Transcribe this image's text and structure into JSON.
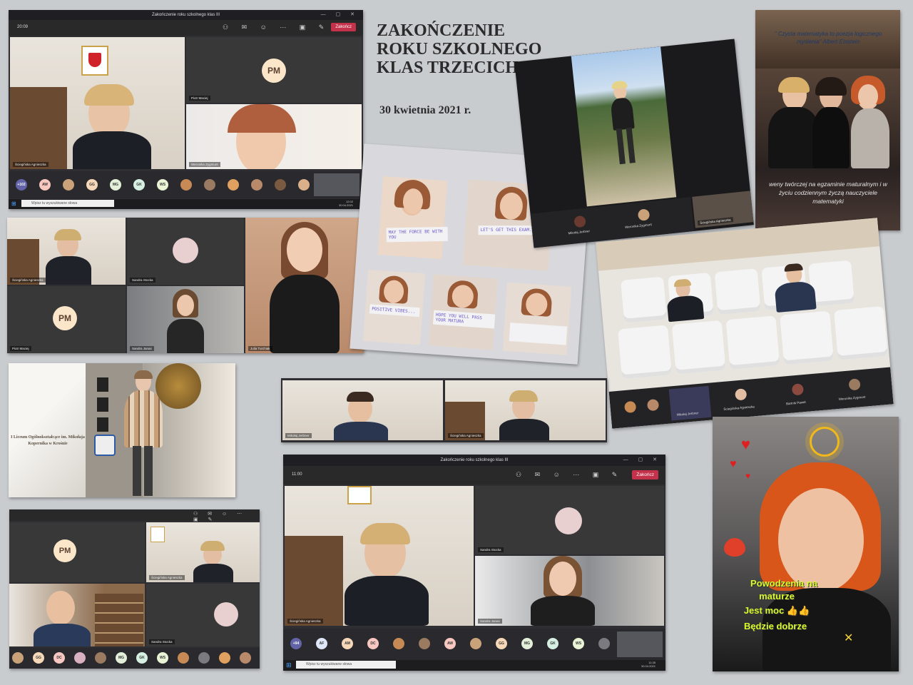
{
  "collage_title": {
    "line1": "ZAKOŃCZENIE",
    "line2": "ROKU SZKOLNEGO",
    "line3": "KLAS TRZECICH",
    "date": "30 kwietnia 2021 r."
  },
  "screen1": {
    "window_title": "Zakończenie roku szkolnego klas III",
    "time": "20:09",
    "end_label": "Zakończ",
    "tiles": [
      {
        "name": "Ściegińska Agnieszka"
      },
      {
        "name": "Piotr Maciej",
        "initials": "PM"
      },
      {
        "name": "Weronika Zygmunt"
      }
    ],
    "strip": [
      "+102",
      "AW",
      "",
      "GG",
      "MG",
      "GK",
      "WS",
      "",
      "",
      "",
      "",
      "",
      ""
    ],
    "search_placeholder": "Wpisz tu wyszukiwane słowa",
    "tray_time": "12:02",
    "tray_date": "30.04.2021"
  },
  "screen2": {
    "tiles": [
      {
        "name": "Ściegińska Agnieszka"
      },
      {
        "name": "Sandra Stocka"
      },
      {
        "name": "Piotr Maciej",
        "initials": "PM"
      },
      {
        "name": "Sandra Janas"
      },
      {
        "name": "Julia Turchiak"
      }
    ]
  },
  "screen_walk": {
    "tiles": [
      {
        "name": "Mikołaj Jerbner"
      },
      {
        "name": "Weronika Zygmunt"
      },
      {
        "name": "Ściegińska Agnieszka"
      }
    ]
  },
  "quote_card": {
    "quote": "\" Czysta matematyka to poezja logicznego myślenia\" Albert Einstein",
    "wish": "weny twórczej na egzaminie maturalnym i w życiu codziennym życzą nauczyciele matematyki"
  },
  "signs_collage": {
    "signs": [
      "MAY THE FORCE BE WITH YOU",
      "LET'S GET THIS EXAM...",
      "POSITIVE VIBES...",
      "HOPE YOU WILL PASS YOUR MATURA",
      ""
    ]
  },
  "auditorium": {
    "strip_names": [
      "Mikołaj Jerbner",
      "Ściegińska Agnieszka",
      "Bartnik Paweł",
      "Weronika Zygmunt"
    ]
  },
  "two_tiles": {
    "tiles": [
      {
        "name": "Mikołaj Jerbner"
      },
      {
        "name": "Ściegińska Agnieszka"
      }
    ]
  },
  "school_hall": {
    "wall_text": "I Liceum Ogólnokształcące im. Mikołaja Kopernika w Krośnie"
  },
  "screen3": {
    "tiles": [
      {
        "name": "",
        "initials": "PM"
      },
      {
        "name": "Ściegińska Agnieszka"
      },
      {
        "name": ""
      },
      {
        "name": "Sandra Stocka"
      }
    ],
    "strip": [
      "",
      "GG",
      "DC",
      "",
      "",
      "MG",
      "GK",
      "WS",
      "",
      "",
      "",
      ""
    ]
  },
  "screen4": {
    "window_title": "Zakończenie roku szkolnego klas III",
    "time": "11:00",
    "end_label": "Zakończ",
    "tiles": [
      {
        "name": "Ściegińska Agnieszka"
      },
      {
        "name": "Sandra Stocka"
      },
      {
        "name": "Sandra Janas"
      }
    ],
    "strip": [
      "+94",
      "AF",
      "AM",
      "DC",
      "",
      "",
      "AW",
      "",
      "GG",
      "MG",
      "GK",
      "WS",
      ""
    ],
    "search_placeholder": "Wpisz tu wyszukiwane słowa",
    "tray_time": "11:35",
    "tray_date": "30.04.2021"
  },
  "selfie": {
    "line1": "Powodzenia na",
    "line2": "maturze",
    "line3": "Jest moc 👍👍",
    "line4": "Będzie dobrze"
  },
  "colors": {
    "teams_bg": "#2f2f33",
    "end_button": "#c4314b",
    "selfie_text": "#d8fa2a"
  }
}
